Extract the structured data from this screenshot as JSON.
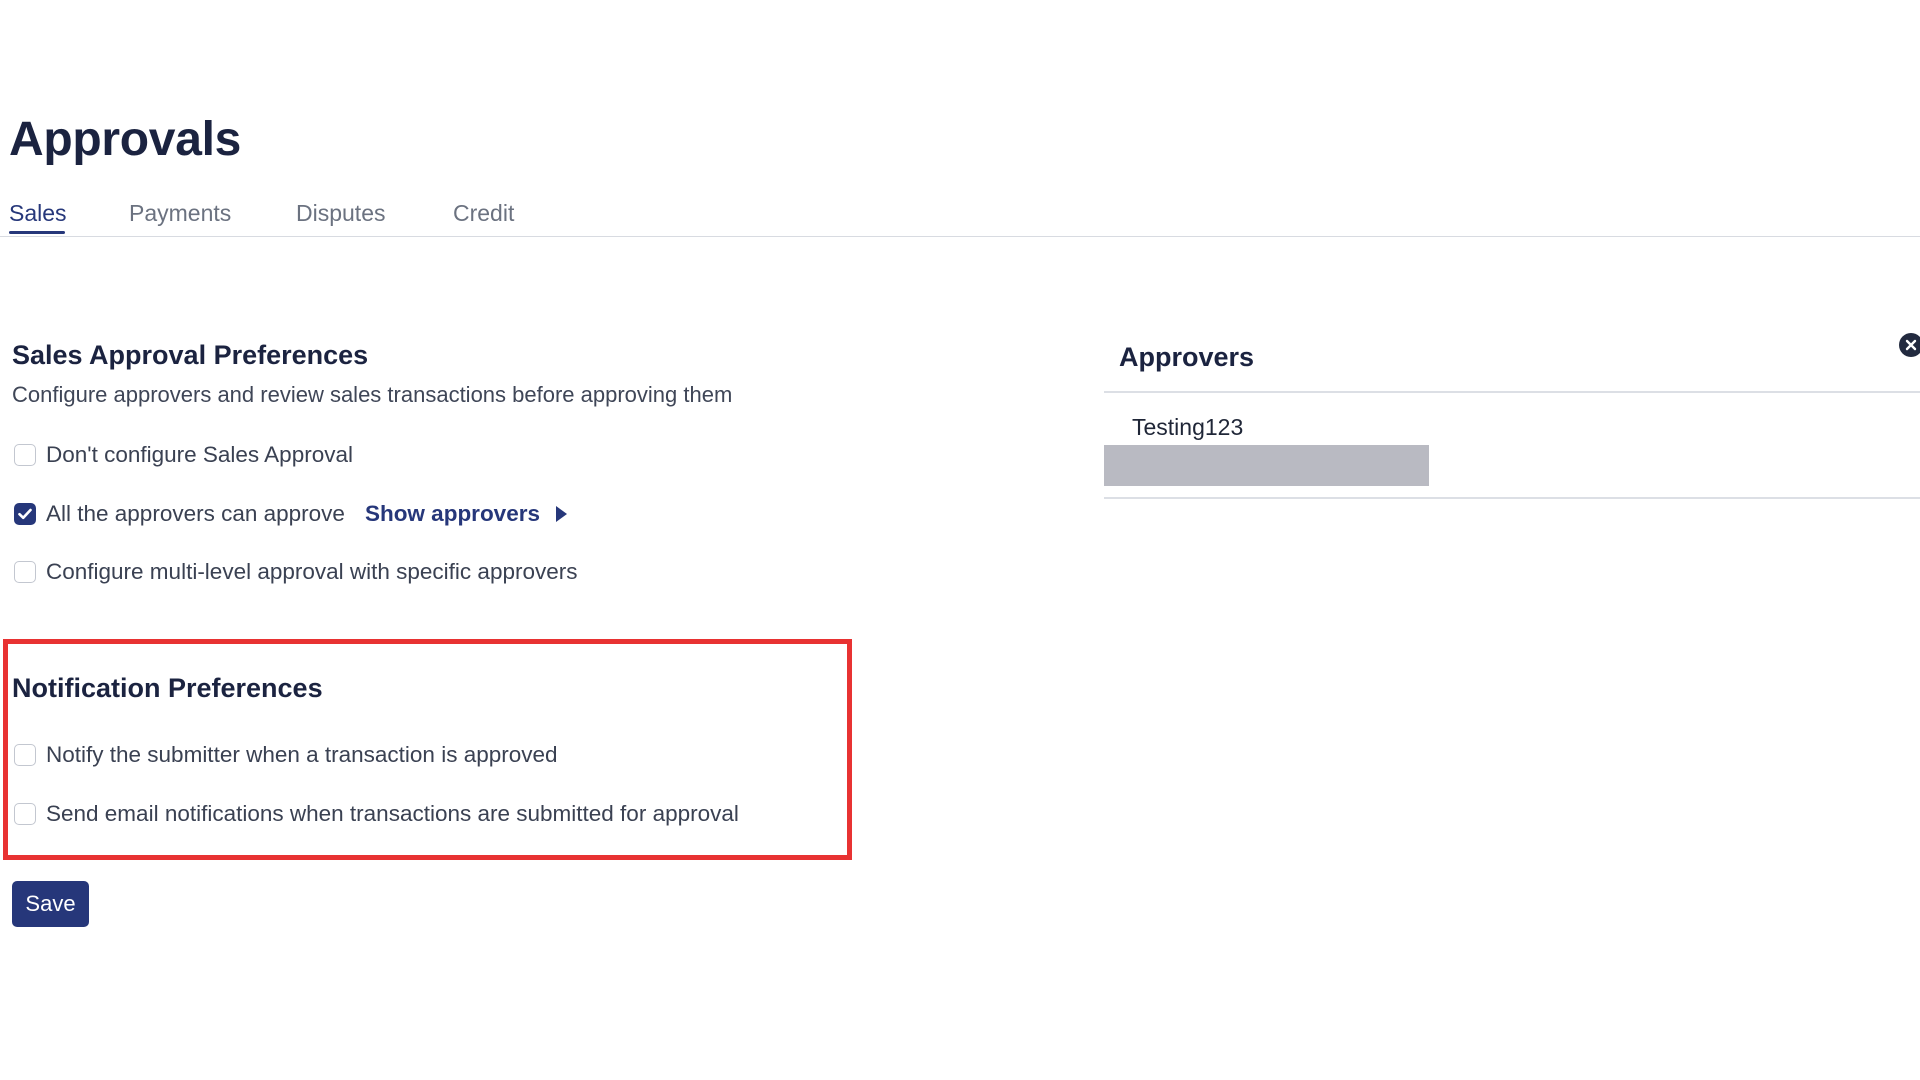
{
  "page": {
    "title": "Approvals"
  },
  "tabs": [
    {
      "label": "Sales",
      "active": true
    },
    {
      "label": "Payments",
      "active": false
    },
    {
      "label": "Disputes",
      "active": false
    },
    {
      "label": "Credit",
      "active": false
    }
  ],
  "sales_approval": {
    "title": "Sales Approval Preferences",
    "description": "Configure approvers and review sales transactions before approving them",
    "options": [
      {
        "label": "Don't configure Sales Approval",
        "checked": false
      },
      {
        "label": "All the approvers can approve",
        "checked": true,
        "link_label": "Show approvers",
        "link_icon": "play-icon"
      },
      {
        "label": "Configure multi-level approval with specific approvers",
        "checked": false
      }
    ]
  },
  "notification": {
    "title": "Notification Preferences",
    "options": [
      {
        "label": "Notify the submitter when a transaction is approved",
        "checked": false
      },
      {
        "label": "Send email notifications when transactions are submitted for approval",
        "checked": false
      }
    ]
  },
  "actions": {
    "save_label": "Save"
  },
  "approvers": {
    "title": "Approvers",
    "close_icon": "close-icon",
    "items": [
      {
        "name": "Testing123"
      }
    ]
  },
  "colors": {
    "primary": "#26377a",
    "highlight": "#e83232",
    "redacted": "#b9bac2",
    "text": "#1b2340"
  }
}
